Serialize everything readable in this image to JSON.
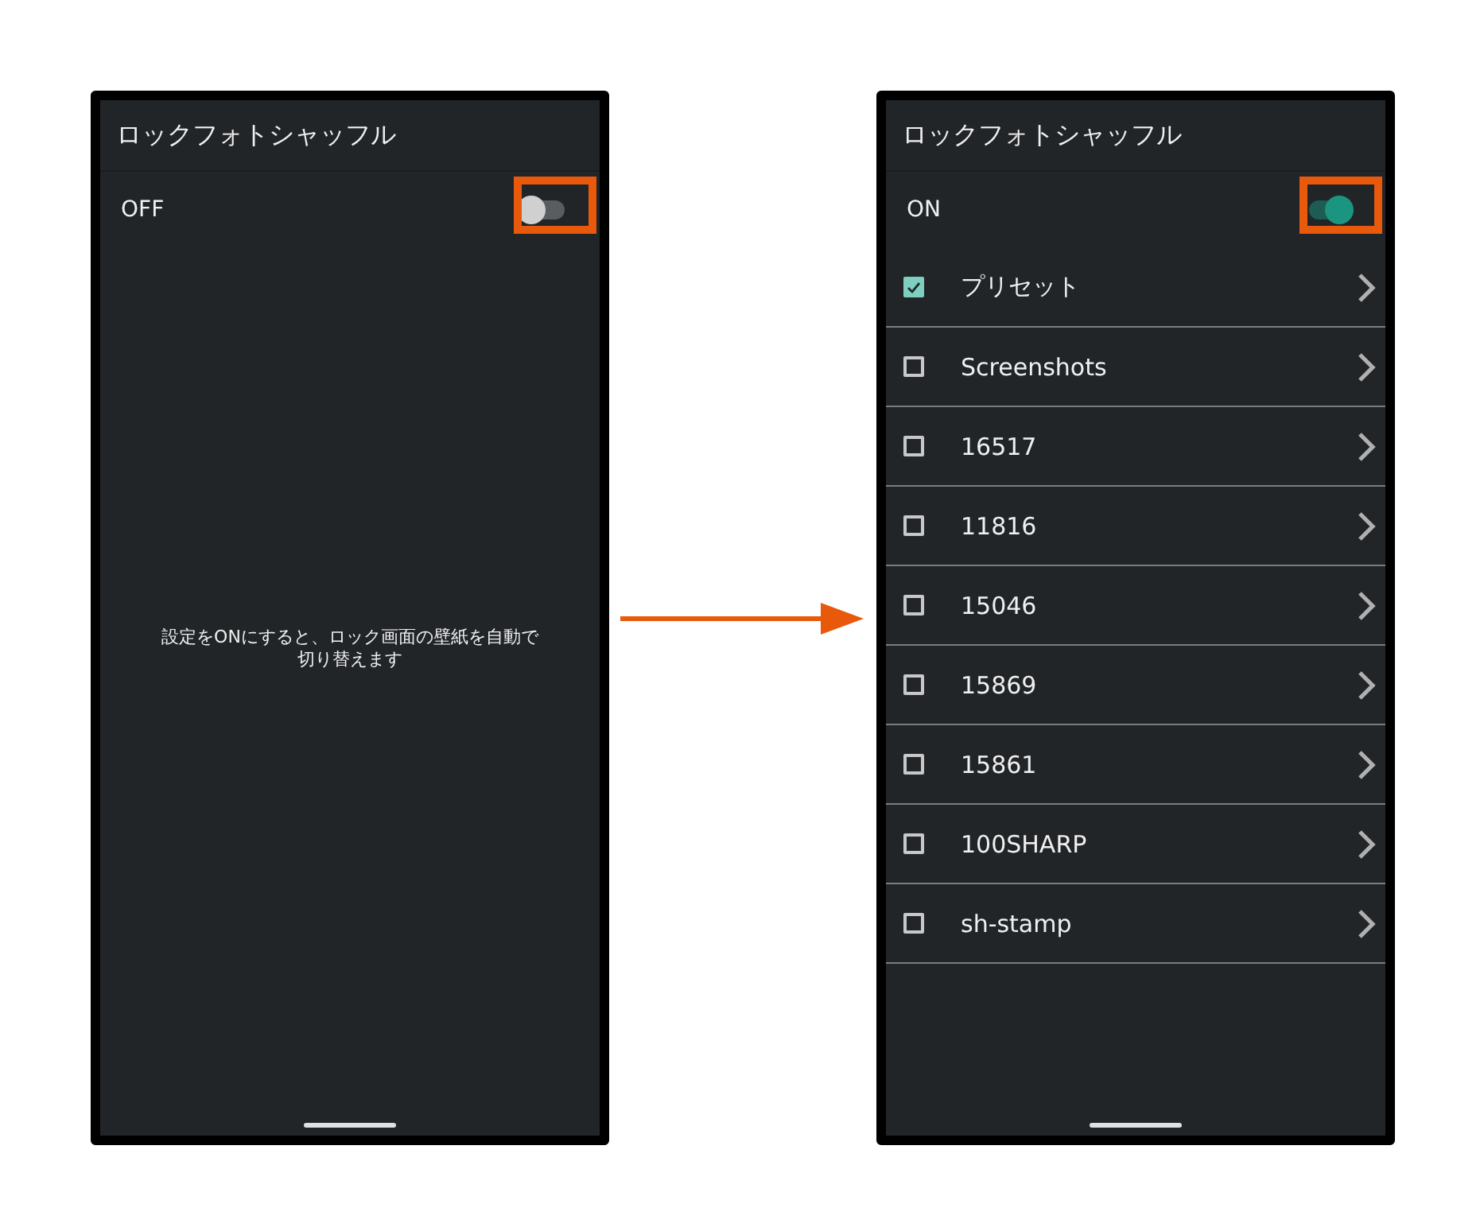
{
  "screens": [
    {
      "title": "ロックフォトシャッフル",
      "switch": {
        "label": "OFF",
        "on": false,
        "highlighted": true
      },
      "hint": "設定をONにすると、ロック画面の壁紙を自動で切り替えます"
    },
    {
      "title": "ロックフォトシャッフル",
      "switch": {
        "label": "ON",
        "on": true,
        "highlighted": true
      },
      "folders": [
        {
          "name": "プリセット",
          "checked": true
        },
        {
          "name": "Screenshots",
          "checked": false
        },
        {
          "name": "16517",
          "checked": false
        },
        {
          "name": "11816",
          "checked": false
        },
        {
          "name": "15046",
          "checked": false
        },
        {
          "name": "15869",
          "checked": false
        },
        {
          "name": "15861",
          "checked": false
        },
        {
          "name": "100SHARP",
          "checked": false
        },
        {
          "name": "sh-stamp",
          "checked": false
        }
      ]
    }
  ]
}
